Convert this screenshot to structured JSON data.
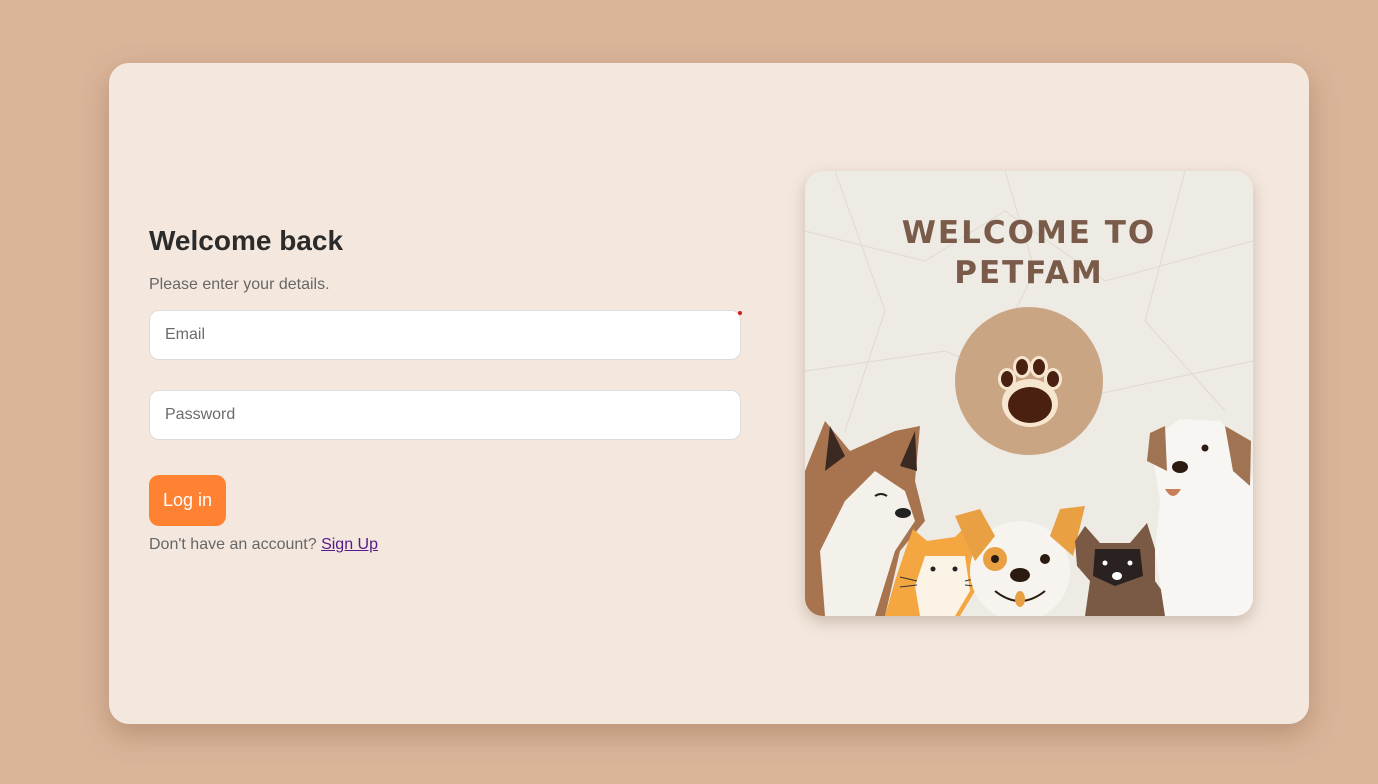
{
  "login": {
    "title": "Welcome back",
    "subtitle": "Please enter your details.",
    "email_placeholder": "Email",
    "password_placeholder": "Password",
    "login_label": "Log in",
    "signup_prompt": "Don't have an account?",
    "signup_link": "Sign Up"
  },
  "illustration": {
    "line1": "WELCOME TO",
    "line2": "PETFAM"
  },
  "colors": {
    "page_bg": "#dab59a",
    "card_bg": "#f4e8de",
    "button": "#ff8233",
    "link": "#551a8b"
  }
}
